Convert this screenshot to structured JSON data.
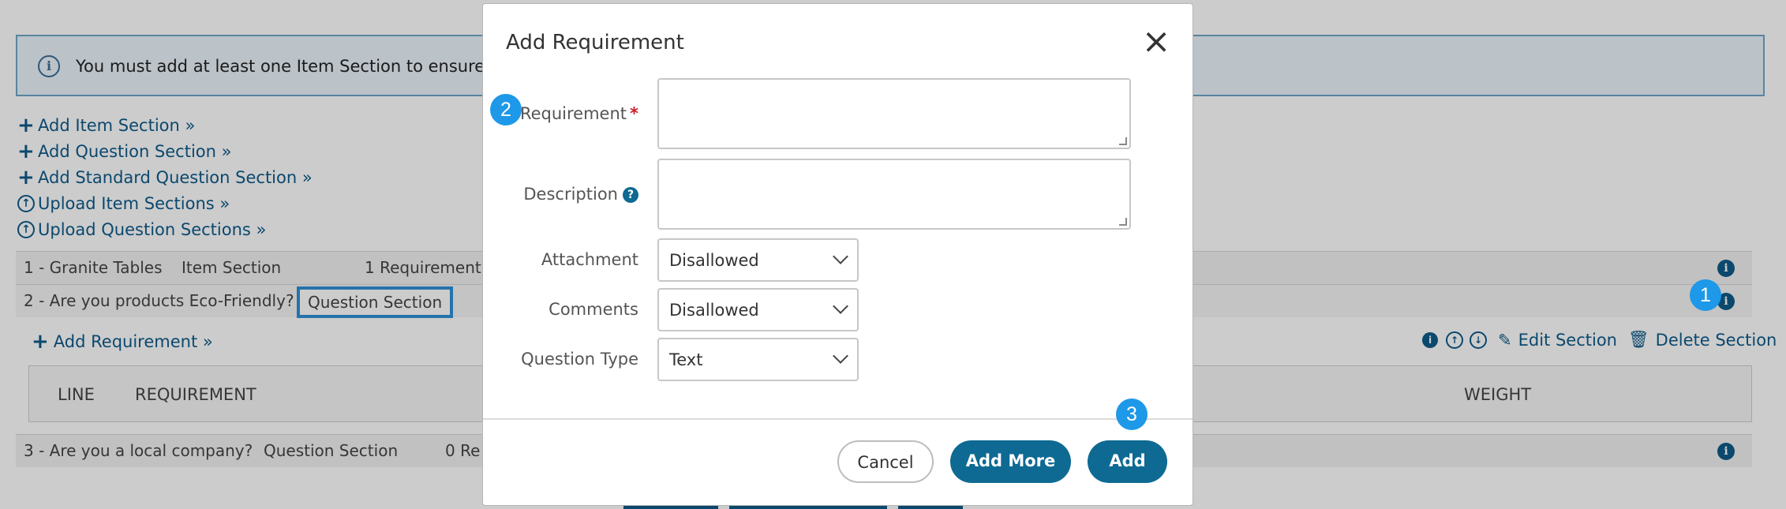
{
  "alert": {
    "message": "You must add at least one Item Section to ensure this R"
  },
  "links": [
    {
      "icon": "plus-icon",
      "label": "Add Item Section »"
    },
    {
      "icon": "plus-icon",
      "label": "Add Question Section »"
    },
    {
      "icon": "plus-icon",
      "label": "Add Standard Question Section »"
    },
    {
      "icon": "upload-icon",
      "label": "Upload Item Sections »"
    },
    {
      "icon": "upload-icon",
      "label": "Upload Question Sections »"
    }
  ],
  "sections": [
    {
      "name": "1 - Granite Tables",
      "type": "Item Section",
      "count": "1 Requirement"
    },
    {
      "name": "2 - Are you products Eco-Friendly?",
      "type": "Question Section",
      "count": ""
    },
    {
      "name": "3 - Are you a local company?",
      "type": "Question Section",
      "count": "0 Re"
    }
  ],
  "section_tools": {
    "add_requirement": "Add Requirement »",
    "edit_section": "Edit Section",
    "delete_section": "Delete Section"
  },
  "table": {
    "columns": [
      "LINE",
      "REQUIREMENT",
      "WEIGHT"
    ]
  },
  "modal": {
    "title": "Add Requirement",
    "fields": {
      "requirement_label": "Requirement",
      "requirement_required_mark": "*",
      "requirement_value": "",
      "description_label": "Description",
      "description_value": "",
      "attachment_label": "Attachment",
      "attachment_value": "Disallowed",
      "comments_label": "Comments",
      "comments_value": "Disallowed",
      "question_type_label": "Question Type",
      "question_type_value": "Text"
    },
    "buttons": {
      "cancel": "Cancel",
      "add_more": "Add More",
      "add": "Add"
    }
  },
  "step_badges": [
    "1",
    "2",
    "3"
  ],
  "colors": {
    "primary": "#0e6a93",
    "link": "#0e5a8a",
    "step_badge": "#1e98e8",
    "required": "#c8202a",
    "highlight_border": "#2f8fd6"
  }
}
